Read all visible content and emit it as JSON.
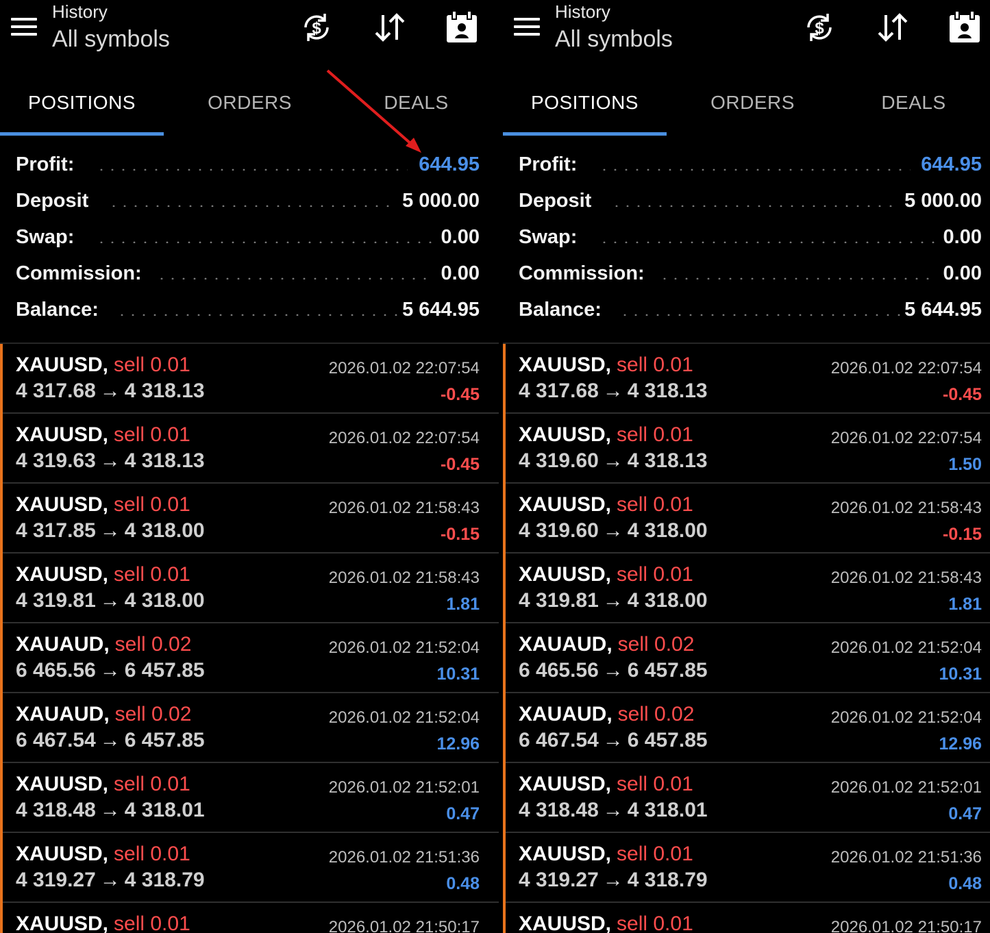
{
  "header": {
    "menu_icon": "hamburger-menu-icon",
    "title_small": "History",
    "title_big": "All symbols",
    "icons": [
      "currency-sync-icon",
      "sort-icon",
      "calendar-icon"
    ]
  },
  "tabs": [
    {
      "label": "POSITIONS",
      "active": true
    },
    {
      "label": "ORDERS",
      "active": false
    },
    {
      "label": "DEALS",
      "active": false
    }
  ],
  "summary": {
    "profit_label": "Profit:",
    "profit_value": "644.95",
    "deposit_label": "Deposit",
    "deposit_value": "5 000.00",
    "swap_label": "Swap:",
    "swap_value": "0.00",
    "commission_label": "Commission:",
    "commission_value": "0.00",
    "balance_label": "Balance:",
    "balance_value": "5 644.95"
  },
  "colors": {
    "accent_blue": "#4a8fe8",
    "loss_red": "#ff4d4d",
    "row_accent_orange": "#e8731c",
    "annotation_red": "#e01e1e"
  },
  "panels": {
    "left": {
      "rows": [
        {
          "symbol": "XAUUSD,",
          "side": "sell 0.01",
          "open": "4 317.68",
          "close": "4 318.13",
          "time": "2026.01.02 22:07:54",
          "pl": "-0.45",
          "sign": "neg"
        },
        {
          "symbol": "XAUUSD,",
          "side": "sell 0.01",
          "open": "4 319.63",
          "close": "4 318.13",
          "time": "2026.01.02 22:07:54",
          "pl": "-0.45",
          "sign": "neg"
        },
        {
          "symbol": "XAUUSD,",
          "side": "sell 0.01",
          "open": "4 317.85",
          "close": "4 318.00",
          "time": "2026.01.02 21:58:43",
          "pl": "-0.15",
          "sign": "neg"
        },
        {
          "symbol": "XAUUSD,",
          "side": "sell 0.01",
          "open": "4 319.81",
          "close": "4 318.00",
          "time": "2026.01.02 21:58:43",
          "pl": "1.81",
          "sign": "pos"
        },
        {
          "symbol": "XAUAUD,",
          "side": "sell 0.02",
          "open": "6 465.56",
          "close": "6 457.85",
          "time": "2026.01.02 21:52:04",
          "pl": "10.31",
          "sign": "pos"
        },
        {
          "symbol": "XAUAUD,",
          "side": "sell 0.02",
          "open": "6 467.54",
          "close": "6 457.85",
          "time": "2026.01.02 21:52:04",
          "pl": "12.96",
          "sign": "pos"
        },
        {
          "symbol": "XAUUSD,",
          "side": "sell 0.01",
          "open": "4 318.48",
          "close": "4 318.01",
          "time": "2026.01.02 21:52:01",
          "pl": "0.47",
          "sign": "pos"
        },
        {
          "symbol": "XAUUSD,",
          "side": "sell 0.01",
          "open": "4 319.27",
          "close": "4 318.79",
          "time": "2026.01.02 21:51:36",
          "pl": "0.48",
          "sign": "pos"
        },
        {
          "symbol": "XAUUSD,",
          "side": "sell 0.01",
          "open": "",
          "close": "",
          "time": "2026.01.02 21:50:17",
          "pl": "",
          "sign": "pos"
        }
      ]
    },
    "right": {
      "rows": [
        {
          "symbol": "XAUUSD,",
          "side": "sell 0.01",
          "open": "4 317.68",
          "close": "4 318.13",
          "time": "2026.01.02 22:07:54",
          "pl": "-0.45",
          "sign": "neg"
        },
        {
          "symbol": "XAUUSD,",
          "side": "sell 0.01",
          "open": "4 319.60",
          "close": "4 318.13",
          "time": "2026.01.02 22:07:54",
          "pl": "1.50",
          "sign": "pos"
        },
        {
          "symbol": "XAUUSD,",
          "side": "sell 0.01",
          "open": "4 319.60",
          "close": "4 318.00",
          "time": "2026.01.02 21:58:43",
          "pl": "-0.15",
          "sign": "neg"
        },
        {
          "symbol": "XAUUSD,",
          "side": "sell 0.01",
          "open": "4 319.81",
          "close": "4 318.00",
          "time": "2026.01.02 21:58:43",
          "pl": "1.81",
          "sign": "pos"
        },
        {
          "symbol": "XAUAUD,",
          "side": "sell 0.02",
          "open": "6 465.56",
          "close": "6 457.85",
          "time": "2026.01.02 21:52:04",
          "pl": "10.31",
          "sign": "pos"
        },
        {
          "symbol": "XAUAUD,",
          "side": "sell 0.02",
          "open": "6 467.54",
          "close": "6 457.85",
          "time": "2026.01.02 21:52:04",
          "pl": "12.96",
          "sign": "pos"
        },
        {
          "symbol": "XAUUSD,",
          "side": "sell 0.01",
          "open": "4 318.48",
          "close": "4 318.01",
          "time": "2026.01.02 21:52:01",
          "pl": "0.47",
          "sign": "pos"
        },
        {
          "symbol": "XAUUSD,",
          "side": "sell 0.01",
          "open": "4 319.27",
          "close": "4 318.79",
          "time": "2026.01.02 21:51:36",
          "pl": "0.48",
          "sign": "pos"
        },
        {
          "symbol": "XAUUSD,",
          "side": "sell 0.01",
          "open": "",
          "close": "",
          "time": "2026.01.02 21:50:17",
          "pl": "",
          "sign": "pos"
        }
      ]
    }
  }
}
